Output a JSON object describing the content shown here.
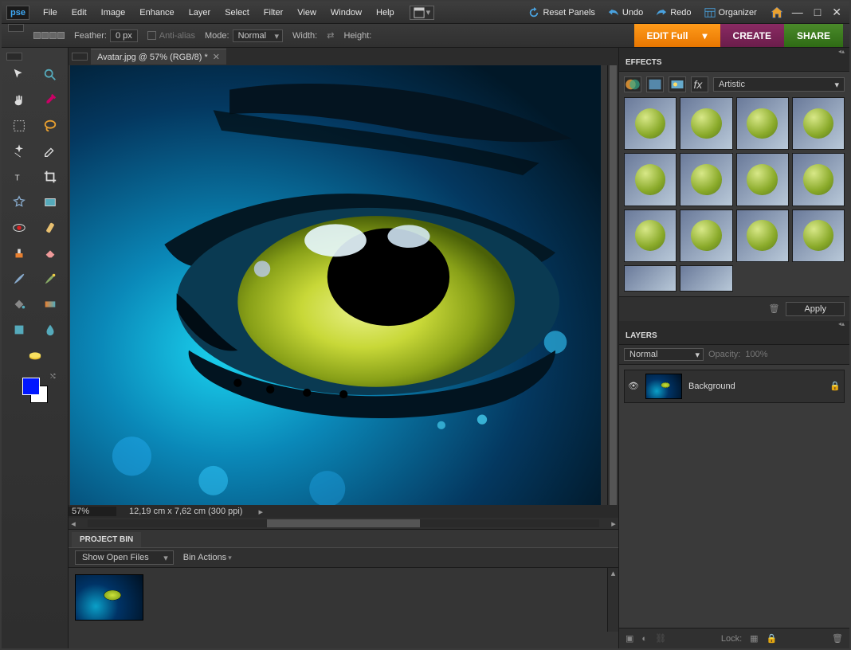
{
  "app": {
    "logo": "pse"
  },
  "menu": {
    "file": "File",
    "edit": "Edit",
    "image": "Image",
    "enhance": "Enhance",
    "layer": "Layer",
    "select": "Select",
    "filter": "Filter",
    "view": "View",
    "window": "Window",
    "help": "Help"
  },
  "topbar": {
    "reset": "Reset Panels",
    "undo": "Undo",
    "redo": "Redo",
    "organizer": "Organizer"
  },
  "options": {
    "feather_label": "Feather:",
    "feather_value": "0 px",
    "antialias": "Anti-alias",
    "mode_label": "Mode:",
    "mode_value": "Normal",
    "width": "Width:",
    "height": "Height:"
  },
  "pills": {
    "edit": "EDIT Full",
    "create": "CREATE",
    "share": "SHARE"
  },
  "document": {
    "tab": "Avatar.jpg @ 57% (RGB/8) *",
    "zoom": "57%",
    "dims": "12,19 cm x 7,62 cm (300 ppi)"
  },
  "bin": {
    "title": "PROJECT BIN",
    "show": "Show Open Files",
    "actions": "Bin Actions"
  },
  "effects": {
    "title": "EFFECTS",
    "category": "Artistic",
    "apply": "Apply"
  },
  "layers": {
    "title": "LAYERS",
    "blend": "Normal",
    "opacity_label": "Opacity:",
    "opacity_value": "100%",
    "lock_label": "Lock:",
    "items": [
      {
        "name": "Background"
      }
    ]
  }
}
